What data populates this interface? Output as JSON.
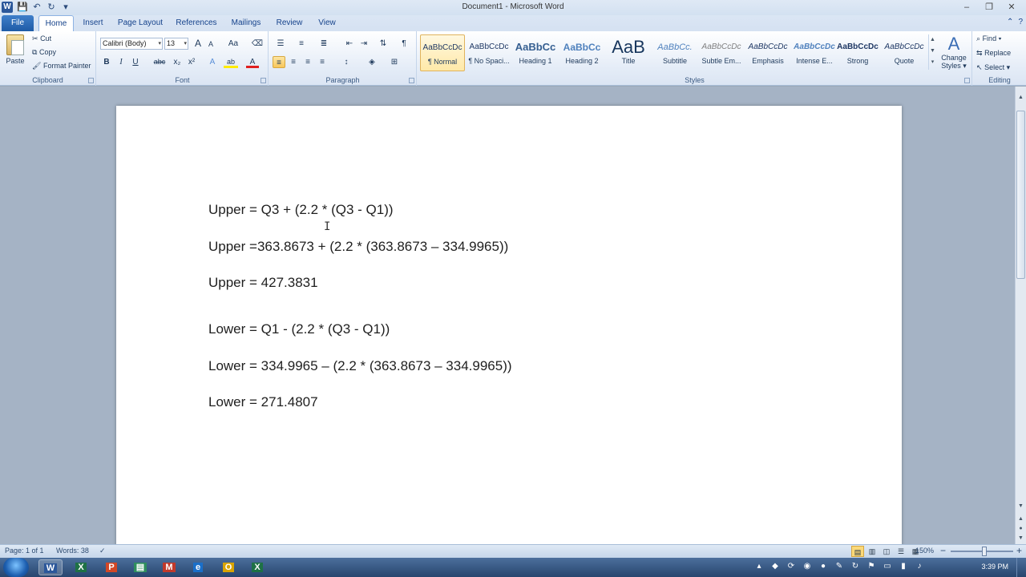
{
  "window": {
    "title": "Document1 - Microsoft Word",
    "app_icon_letter": "W",
    "minimize": "–",
    "restore": "❐",
    "close": "✕"
  },
  "quick_access": {
    "save": "💾",
    "undo": "↶",
    "redo": "↻",
    "customize": "▾"
  },
  "tabs": {
    "file": "File",
    "home": "Home",
    "insert": "Insert",
    "page_layout": "Page Layout",
    "references": "References",
    "mailings": "Mailings",
    "review": "Review",
    "view": "View",
    "help_glyph": "?"
  },
  "clipboard": {
    "label": "Clipboard",
    "paste": "Paste",
    "cut": "Cut",
    "copy": "Copy",
    "format_painter": "Format Painter"
  },
  "font": {
    "label": "Font",
    "font_name": "Calibri (Body)",
    "font_size": "13",
    "grow": "A",
    "shrink": "A",
    "change_case": "Aa",
    "bold": "B",
    "italic": "I",
    "underline": "U",
    "strikethrough": "abc",
    "subscript": "x₂",
    "superscript": "x²",
    "text_effects": "A",
    "highlight": "ab",
    "font_color": "A"
  },
  "paragraph": {
    "label": "Paragraph",
    "show_marks": "¶"
  },
  "styles": {
    "label": "Styles",
    "items": [
      {
        "preview": "AaBbCcDc",
        "name": "¶ Normal"
      },
      {
        "preview": "AaBbCcDc",
        "name": "¶ No Spaci..."
      },
      {
        "preview": "AaBbCc",
        "name": "Heading 1"
      },
      {
        "preview": "AaBbCc",
        "name": "Heading 2"
      },
      {
        "preview": "AaB",
        "name": "Title"
      },
      {
        "preview": "AaBbCc.",
        "name": "Subtitle"
      },
      {
        "preview": "AaBbCcDc",
        "name": "Subtle Em..."
      },
      {
        "preview": "AaBbCcDc",
        "name": "Emphasis"
      },
      {
        "preview": "AaBbCcDc",
        "name": "Intense E..."
      },
      {
        "preview": "AaBbCcDc",
        "name": "Strong"
      },
      {
        "preview": "AaBbCcDc",
        "name": "Quote"
      }
    ],
    "change_styles": "Change Styles ▾"
  },
  "editing": {
    "label": "Editing",
    "find": "Find ▾",
    "replace": "Replace",
    "select": "Select ▾"
  },
  "document": {
    "lines": [
      "Upper = Q3 + (2.2 * (Q3 - Q1))",
      "Upper =363.8673 + (2.2 * (363.8673 – 334.9965))",
      "Upper = 427.3831",
      "Lower = Q1 - (2.2 * (Q3 - Q1))",
      "Lower = 334.9965 – (2.2 * (363.8673 – 334.9965))",
      "Lower = 271.4807"
    ]
  },
  "status": {
    "page": "Page: 1 of 1",
    "words": "Words: 38",
    "zoom": "150%",
    "zoom_out": "−",
    "zoom_in": "+"
  },
  "taskbar": {
    "clock": "3:39 PM"
  },
  "colors": {
    "accent": "#2b579a",
    "ribbon": "#dbe5f3",
    "taskbar": "#27456e"
  }
}
